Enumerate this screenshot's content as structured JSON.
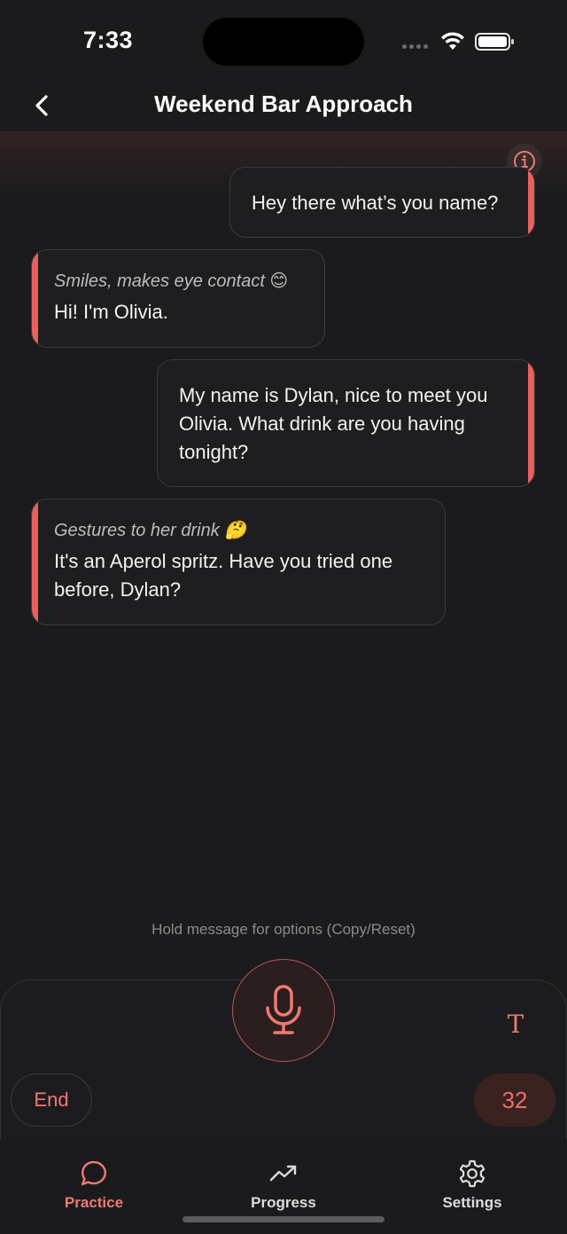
{
  "status": {
    "time": "7:33"
  },
  "header": {
    "title": "Weekend Bar Approach"
  },
  "messages": [
    {
      "role": "user",
      "text": "Hey there what’s you name?"
    },
    {
      "role": "ai",
      "action": "Smiles, makes eye contact 😊",
      "text": "Hi! I'm Olivia."
    },
    {
      "role": "user",
      "text": "My name is Dylan, nice to meet you Olivia. What drink are you having tonight?"
    },
    {
      "role": "ai",
      "action": "Gestures to her drink 🤔",
      "text": "It's an Aperol spritz. Have you tried one before, Dylan?"
    }
  ],
  "hint": "Hold message for options (Copy/Reset)",
  "controls": {
    "end_label": "End",
    "text_mode_glyph": "T",
    "count": "32"
  },
  "tabs": [
    {
      "label": "Practice",
      "icon": "chat-bubble-icon",
      "active": true
    },
    {
      "label": "Progress",
      "icon": "trending-up-icon",
      "active": false
    },
    {
      "label": "Settings",
      "icon": "gear-icon",
      "active": false
    }
  ],
  "colors": {
    "accent": "#ee7a72",
    "background": "#1b1b1d",
    "bubble_border": "#3b3b3e"
  }
}
